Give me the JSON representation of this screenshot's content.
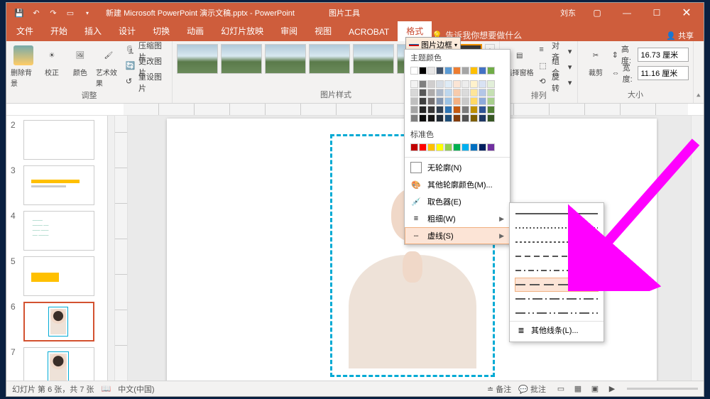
{
  "titlebar": {
    "document": "新建 Microsoft PowerPoint 演示文稿.pptx - PowerPoint",
    "pictools": "图片工具",
    "username": "刘东"
  },
  "tabs": {
    "file": "文件",
    "home": "开始",
    "insert": "插入",
    "design": "设计",
    "transitions": "切换",
    "animations": "动画",
    "slideshow": "幻灯片放映",
    "review": "审阅",
    "view": "视图",
    "acrobat": "ACROBAT",
    "format": "格式",
    "tellme": "告诉我你想要做什么",
    "share": "共享"
  },
  "ribbon": {
    "removebg": "删除背景",
    "corrections": "校正",
    "color": "颜色",
    "artistic": "艺术效果",
    "compress": "压缩图片",
    "change": "更改图片",
    "reset": "重设图片",
    "adjust_group": "调整",
    "styles_group": "图片样式",
    "border_drop": "图片边框",
    "selection_pane": "选择窗格",
    "align": "对齐",
    "group": "组合",
    "rotate": "旋转",
    "arrange_group": "排列",
    "crop": "裁剪",
    "height_label": "高度:",
    "height_value": "16.73 厘米",
    "width_label": "宽度:",
    "width_value": "11.16 厘米",
    "size_group": "大小"
  },
  "border_menu": {
    "theme_colors": "主题颜色",
    "standard_colors": "标准色",
    "no_outline": "无轮廓(N)",
    "more_colors": "其他轮廓颜色(M)...",
    "eyedropper": "取色器(E)",
    "weight": "粗细(W)",
    "dashes": "虚线(S)",
    "more_lines": "其他线条(L)...",
    "theme_row1": [
      "#ffffff",
      "#000000",
      "#e7e6e6",
      "#44546a",
      "#5b9bd5",
      "#ed7d31",
      "#a5a5a5",
      "#ffc000",
      "#4472c4",
      "#70ad47"
    ],
    "theme_shades": [
      [
        "#f2f2f2",
        "#7f7f7f",
        "#d0cece",
        "#d6dce4",
        "#deebf6",
        "#fbe5d5",
        "#ededed",
        "#fff2cc",
        "#d9e2f3",
        "#e2efd9"
      ],
      [
        "#d8d8d8",
        "#595959",
        "#aeabab",
        "#adb9ca",
        "#bdd7ee",
        "#f7cbac",
        "#dbdbdb",
        "#fee599",
        "#b4c6e7",
        "#c5e0b3"
      ],
      [
        "#bfbfbf",
        "#3f3f3f",
        "#757070",
        "#8496b0",
        "#9cc3e5",
        "#f4b183",
        "#c9c9c9",
        "#ffd965",
        "#8eaadb",
        "#a8d08d"
      ],
      [
        "#a5a5a5",
        "#262626",
        "#3a3838",
        "#323f4f",
        "#2e75b5",
        "#c55a11",
        "#7b7b7b",
        "#bf9000",
        "#2f5496",
        "#538135"
      ],
      [
        "#7f7f7f",
        "#0c0c0c",
        "#171616",
        "#222a35",
        "#1e4e79",
        "#833c0b",
        "#525252",
        "#7f6000",
        "#1f3864",
        "#375623"
      ]
    ],
    "standard_row": [
      "#c00000",
      "#ff0000",
      "#ffc000",
      "#ffff00",
      "#92d050",
      "#00b050",
      "#00b0f0",
      "#0070c0",
      "#002060",
      "#7030a0"
    ]
  },
  "dash_styles": [
    "solid",
    "round-dot",
    "square-dot",
    "dash",
    "dash-dot",
    "long-dash",
    "long-dash-dot",
    "long-dash-dot-dot"
  ],
  "slides": [
    {
      "num": "2"
    },
    {
      "num": "3"
    },
    {
      "num": "4"
    },
    {
      "num": "5"
    },
    {
      "num": "6"
    },
    {
      "num": "7"
    }
  ],
  "status": {
    "slide_info": "幻灯片 第 6 张，共 7 张",
    "lang": "中文(中国)",
    "notes": "备注",
    "comments": "批注"
  },
  "annotation": {
    "arrow_color": "#ff00ff"
  }
}
